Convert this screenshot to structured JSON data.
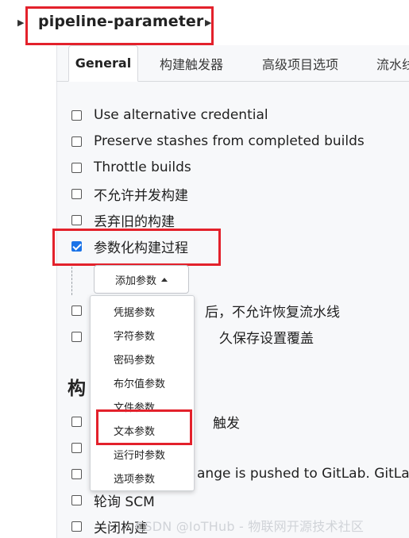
{
  "breadcrumb": {
    "title": "pipeline-parameter"
  },
  "tabs": [
    {
      "label": "General"
    },
    {
      "label": "构建触发器"
    },
    {
      "label": "高级项目选项"
    },
    {
      "label": "流水线"
    }
  ],
  "options": [
    {
      "label": "Use alternative credential",
      "checked": false
    },
    {
      "label": "Preserve stashes from completed builds",
      "checked": false
    },
    {
      "label": "Throttle builds",
      "checked": false
    },
    {
      "label": "不允许并发构建",
      "checked": false
    },
    {
      "label": "丢弃旧的构建",
      "checked": false
    },
    {
      "label": "参数化构建过程",
      "checked": true
    },
    {
      "label": "后，不允许恢复流水线",
      "checked": false
    },
    {
      "label": "久保存设置覆盖",
      "checked": false
    }
  ],
  "add_parameter": {
    "label": "添加参数"
  },
  "dropdown_items": [
    "凭据参数",
    "字符参数",
    "密码参数",
    "布尔值参数",
    "文件参数",
    "文本参数",
    "运行时参数",
    "选项参数"
  ],
  "build_section": {
    "heading": "构",
    "options": [
      {
        "label": "触发",
        "checked": false
      },
      {
        "label": "",
        "checked": false
      },
      {
        "label": "ange is pushed to GitLab. GitLab w",
        "checked": false
      },
      {
        "label": "轮询 SCM",
        "checked": false
      },
      {
        "label": "关闭构建",
        "checked": false
      }
    ]
  },
  "watermark": "CSDN @IoTHub - 物联网开源技术社区",
  "colors": {
    "highlight": "#e3212b",
    "checkbox_checked": "#1a73e8",
    "panel_bg": "#f7f8fa"
  }
}
